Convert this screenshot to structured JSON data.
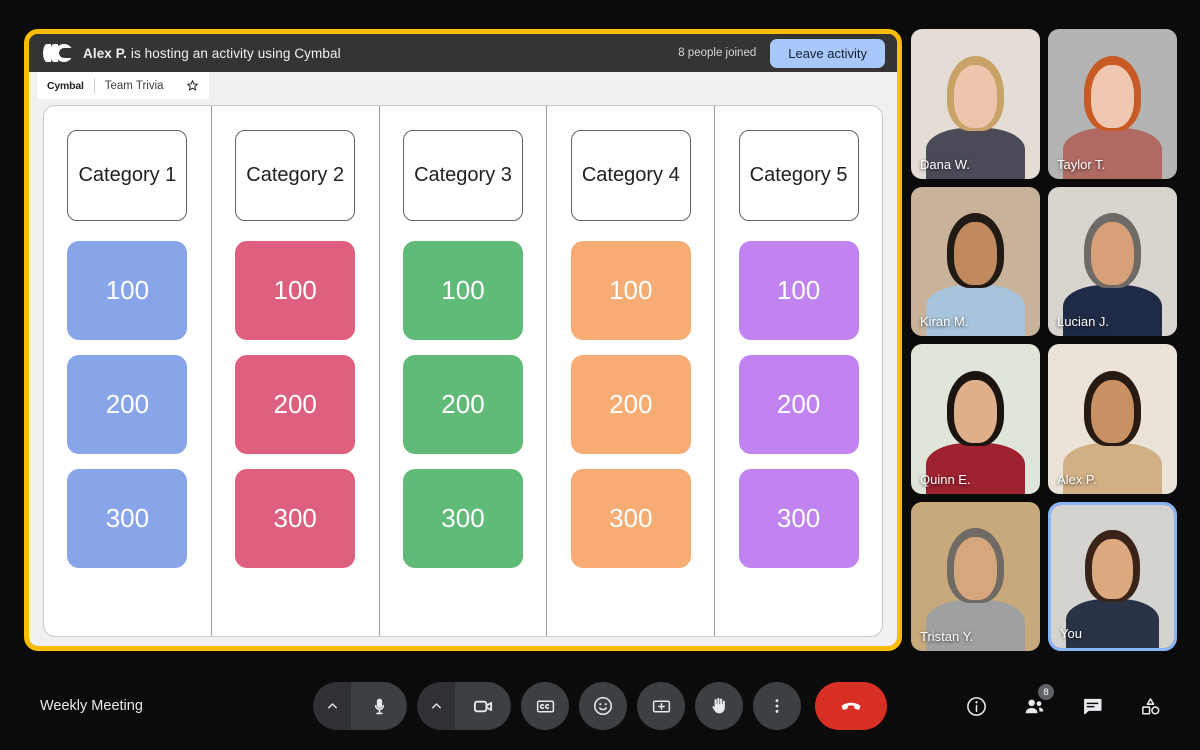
{
  "activity": {
    "host_banner": "Alex P. is hosting an activity using Cymbal",
    "host_name_bold": "Alex P.",
    "joined_count_label": "8 people joined",
    "leave_button_label": "Leave activity",
    "logo_icon": "cymbal-logo-icon",
    "tab": {
      "brand": "Cymbal",
      "title": "Team Trivia",
      "star_icon": "star-icon"
    },
    "frame_color": "#FBBC04",
    "board": {
      "columns": [
        {
          "category": "Category 1",
          "color": "#87A5E8",
          "tiles": [
            "100",
            "200",
            "300"
          ]
        },
        {
          "category": "Category 2",
          "color": "#DE5F7E",
          "tiles": [
            "100",
            "200",
            "300"
          ]
        },
        {
          "category": "Category 3",
          "color": "#5FBB77",
          "tiles": [
            "100",
            "200",
            "300"
          ]
        },
        {
          "category": "Category 4",
          "color": "#F7AC74",
          "tiles": [
            "100",
            "200",
            "300"
          ]
        },
        {
          "category": "Category 5",
          "color": "#C183F0",
          "tiles": [
            "100",
            "200",
            "300"
          ]
        }
      ]
    }
  },
  "participants": [
    {
      "name": "Dana W.",
      "is_you": false
    },
    {
      "name": "Taylor T.",
      "is_you": false
    },
    {
      "name": "Kiran M.",
      "is_you": false
    },
    {
      "name": "Lucian J.",
      "is_you": false
    },
    {
      "name": "Quinn E.",
      "is_you": false
    },
    {
      "name": "Alex P.",
      "is_you": false
    },
    {
      "name": "Tristan Y.",
      "is_you": false
    },
    {
      "name": "You",
      "is_you": true
    }
  ],
  "bottom_bar": {
    "meeting_name": "Weekly Meeting",
    "controls": [
      {
        "name": "microphone-button",
        "icon": "microphone-icon",
        "has_chevron": true
      },
      {
        "name": "camera-button",
        "icon": "camera-icon",
        "has_chevron": true
      },
      {
        "name": "captions-button",
        "icon": "closed-captions-icon",
        "has_chevron": false
      },
      {
        "name": "emoji-button",
        "icon": "emoji-smiley-icon",
        "has_chevron": false
      },
      {
        "name": "present-button",
        "icon": "present-screen-icon",
        "has_chevron": false
      },
      {
        "name": "raise-hand-button",
        "icon": "raised-hand-icon",
        "has_chevron": false
      },
      {
        "name": "more-options-button",
        "icon": "more-vertical-icon",
        "has_chevron": false
      }
    ],
    "hangup": {
      "name": "leave-call-button",
      "icon": "phone-hangup-icon",
      "color": "#D93025"
    },
    "right_controls": [
      {
        "name": "meeting-details-button",
        "icon": "info-circle-icon",
        "badge": null
      },
      {
        "name": "people-button",
        "icon": "people-icon",
        "badge": "8"
      },
      {
        "name": "chat-button",
        "icon": "chat-bubble-icon",
        "badge": null
      },
      {
        "name": "activities-button",
        "icon": "activities-shapes-icon",
        "badge": null
      }
    ]
  }
}
